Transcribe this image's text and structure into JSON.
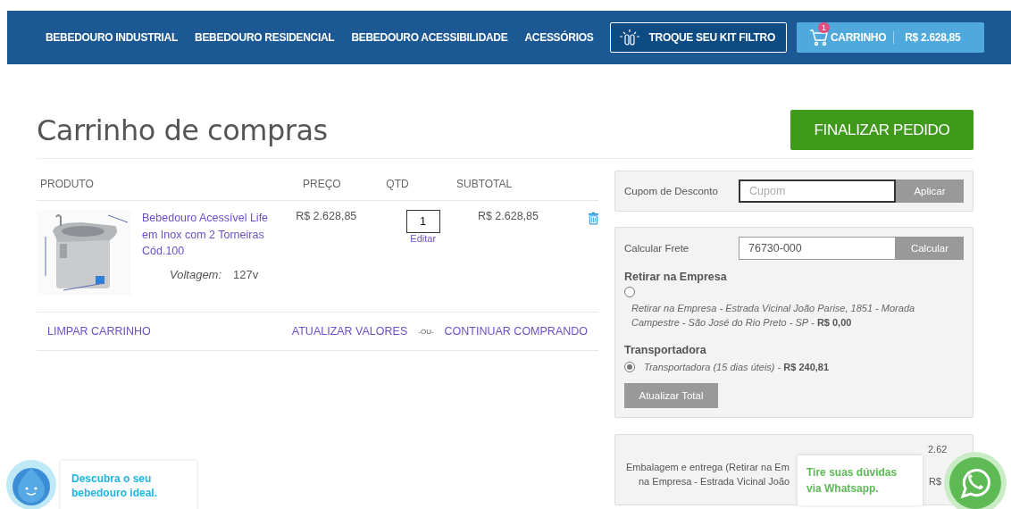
{
  "nav": {
    "items": [
      "BEBEDOURO INDUSTRIAL",
      "BEBEDOURO RESIDENCIAL",
      "BEBEDOURO ACESSIBILIDADE",
      "ACESSÓRIOS"
    ],
    "kit_button": "TROQUE SEU KIT FILTRO",
    "cart": {
      "badge": "1",
      "label": "CARRINHO",
      "total": "R$ 2.628,85"
    }
  },
  "title": "Carrinho de compras",
  "checkout_button": "FINALIZAR PEDIDO",
  "table": {
    "columns": [
      "PRODUTO",
      "PREÇO",
      "QTD",
      "SUBTOTAL"
    ],
    "rows": [
      {
        "image": {
          "kind": "picture"
        },
        "product": "Bebedouro Acessível Life em Inox com 2 Torneiras Cód.100",
        "price": "R$ 2.628,85",
        "qty": "1",
        "edit": "Editar",
        "subtotal": "R$ 2.628,85",
        "options": [
          {
            "label": "Voltagem:",
            "value": "127v"
          }
        ]
      }
    ]
  },
  "actions": {
    "clear": "LIMPAR CARRINHO",
    "update": "ATUALIZAR VALORES",
    "separator": "-OU-",
    "continue": "CONTINUAR COMPRANDO"
  },
  "coupon": {
    "label": "Cupom de Desconto",
    "placeholder": "Cupom",
    "button": "Aplicar"
  },
  "shipping": {
    "label": "Calcular Frete",
    "value": "76730-000",
    "button": "Calcular",
    "groups": [
      {
        "title": "Retirar na Empresa",
        "options": [
          {
            "text": "*Retirar na Empresa - Estrada Vicinal João Parise, 1851 - Morada Campestre - São José do Rio Preto - SP* - **R$ 0,00**",
            "selected": false,
            "kind": "stacked"
          }
        ]
      },
      {
        "title": "Transportadora",
        "options": [
          {
            "text": "*Transportadora (15 dias úteis)* - **R$ 240,81**",
            "selected": true,
            "kind": "inline"
          }
        ]
      }
    ],
    "update_button": "Atualizar Total"
  },
  "summary": {
    "amount": "2.62",
    "lines": [
      "Embalagem e entrega (Retirar na Em",
      "na Empresa - Estrada Vicinal João"
    ],
    "amount_2": "R$"
  },
  "helper_chat": {
    "text": "Descubra o seu bebedouro ideal."
  },
  "whatsapp_chat": {
    "text": "Tire suas dúvidas via Whatsapp."
  }
}
